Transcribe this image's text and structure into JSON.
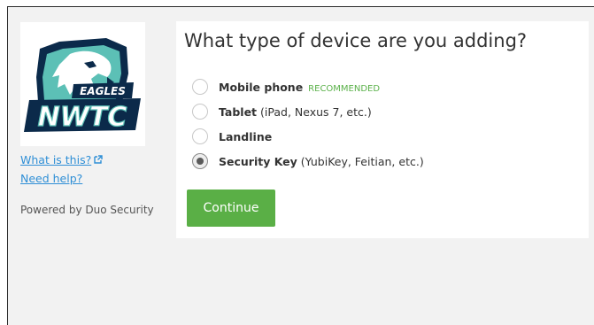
{
  "logo": {
    "text_top": "EAGLES",
    "text_main": "NWTC"
  },
  "side": {
    "what_is_this": "What is this?",
    "need_help": "Need help?",
    "powered_by": "Powered by Duo Security"
  },
  "prompt": {
    "title": "What type of device are you adding?",
    "options": [
      {
        "title": "Mobile phone",
        "detail": "",
        "badge": "RECOMMENDED",
        "selected": false
      },
      {
        "title": "Tablet",
        "detail": " (iPad, Nexus 7, etc.)",
        "badge": "",
        "selected": false
      },
      {
        "title": "Landline",
        "detail": "",
        "badge": "",
        "selected": false
      },
      {
        "title": "Security Key",
        "detail": " (YubiKey, Feitian, etc.)",
        "badge": "",
        "selected": true
      }
    ],
    "continue_label": "Continue"
  },
  "colors": {
    "accent_green": "#5aaf46",
    "link_blue": "#2f8fd6",
    "logo_navy": "#0b2a4a",
    "logo_teal": "#5cc0b6"
  },
  "icons": {
    "external_link": "external-link-icon",
    "logo": "eagle-logo-icon"
  }
}
